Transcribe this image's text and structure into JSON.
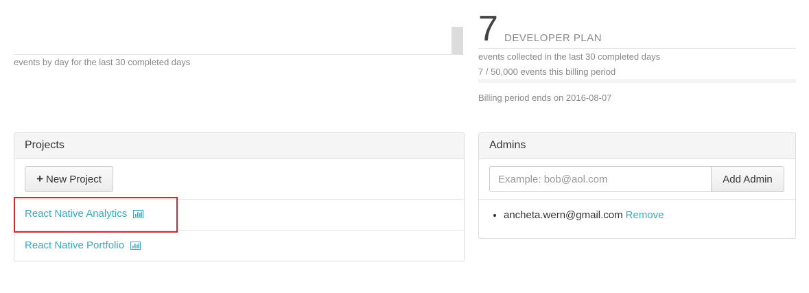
{
  "events_chart": {
    "caption": "events by day for the last 30 completed days",
    "latest_day_level": 0.5,
    "bar_color": "#dcdcdc"
  },
  "plan": {
    "event_count": "7",
    "name": "DEVELOPER PLAN",
    "collected_text": "events collected in the last 30 completed days",
    "usage_text": "7 / 50,000 events this billing period",
    "usage_fraction": 0.00014,
    "billing_end_text": "Billing period ends on 2016-08-07"
  },
  "projects": {
    "title": "Projects",
    "new_project_label": "New Project",
    "new_project_icon": "plus-icon",
    "items": [
      {
        "label": "React Native Analytics",
        "icon": "bar-chart-icon",
        "highlighted": true
      },
      {
        "label": "React Native Portfolio",
        "icon": "bar-chart-icon",
        "highlighted": false
      }
    ]
  },
  "admins": {
    "title": "Admins",
    "input_value": "",
    "input_placeholder": "Example: bob@aol.com",
    "add_label": "Add Admin",
    "list": [
      {
        "email": "ancheta.wern@gmail.com",
        "remove_label": "Remove"
      }
    ]
  },
  "colors": {
    "link": "#3aa8b8",
    "highlight_border": "#d9232e",
    "panel_heading_bg": "#f5f5f5"
  }
}
